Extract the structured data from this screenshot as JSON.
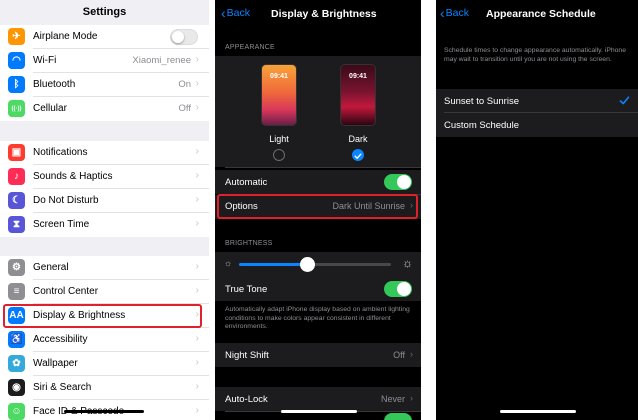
{
  "panel1": {
    "title": "Settings",
    "group1": [
      {
        "label": "Airplane Mode",
        "icon": "airplane-icon",
        "color": "#ff9500",
        "glyph": "✈",
        "type": "toggle",
        "toggle_on": false
      },
      {
        "label": "Wi-Fi",
        "icon": "wifi-icon",
        "color": "#007aff",
        "glyph": "◠",
        "value": "Xiaomi_renee",
        "type": "nav"
      },
      {
        "label": "Bluetooth",
        "icon": "bluetooth-icon",
        "color": "#007aff",
        "glyph": "ᛒ",
        "value": "On",
        "type": "nav"
      },
      {
        "label": "Cellular",
        "icon": "cellular-icon",
        "color": "#4cd964",
        "glyph": "((·))",
        "value": "Off",
        "type": "nav"
      }
    ],
    "group2": [
      {
        "label": "Notifications",
        "icon": "notifications-icon",
        "color": "#ff3b30",
        "glyph": "▣"
      },
      {
        "label": "Sounds & Haptics",
        "icon": "sounds-icon",
        "color": "#ff2d55",
        "glyph": "♪"
      },
      {
        "label": "Do Not Disturb",
        "icon": "moon-icon",
        "color": "#5856d6",
        "glyph": "☾"
      },
      {
        "label": "Screen Time",
        "icon": "hourglass-icon",
        "color": "#5856d6",
        "glyph": "⧗"
      }
    ],
    "group3": [
      {
        "label": "General",
        "icon": "gear-icon",
        "color": "#8e8e93",
        "glyph": "⚙"
      },
      {
        "label": "Control Center",
        "icon": "control-center-icon",
        "color": "#8e8e93",
        "glyph": "≡"
      },
      {
        "label": "Display & Brightness",
        "icon": "display-brightness-icon",
        "color": "#007aff",
        "glyph": "AA"
      },
      {
        "label": "Accessibility",
        "icon": "accessibility-icon",
        "color": "#007aff",
        "glyph": "♿"
      },
      {
        "label": "Wallpaper",
        "icon": "wallpaper-icon",
        "color": "#34aadc",
        "glyph": "✿"
      },
      {
        "label": "Siri & Search",
        "icon": "siri-icon",
        "color": "#1c1c1e",
        "glyph": "◉"
      },
      {
        "label": "Face ID & Passcode",
        "icon": "faceid-icon",
        "color": "#4cd964",
        "glyph": "☺"
      }
    ]
  },
  "panel2": {
    "back_label": "Back",
    "title": "Display & Brightness",
    "appearance_header": "APPEARANCE",
    "light": {
      "time": "09:41",
      "label": "Light",
      "selected": false
    },
    "dark": {
      "time": "09:41",
      "label": "Dark",
      "selected": true
    },
    "automatic_label": "Automatic",
    "automatic_on": true,
    "options_label": "Options",
    "options_value": "Dark Until Sunrise",
    "brightness_header": "BRIGHTNESS",
    "brightness_level": 0.45,
    "true_tone_label": "True Tone",
    "true_tone_on": true,
    "true_tone_desc": "Automatically adapt iPhone display based on ambient lighting conditions to make colors appear consistent in different environments.",
    "night_shift_label": "Night Shift",
    "night_shift_value": "Off",
    "auto_lock_label": "Auto-Lock",
    "auto_lock_value": "Never"
  },
  "panel3": {
    "back_label": "Back",
    "title": "Appearance Schedule",
    "description": "Schedule times to change appearance automatically. iPhone may wait to transition until you are not using the screen.",
    "options": [
      {
        "label": "Sunset to Sunrise",
        "selected": true
      },
      {
        "label": "Custom Schedule",
        "selected": false
      }
    ]
  },
  "colors": {
    "ios_blue": "#0a84ff",
    "ios_green": "#34c759",
    "highlight_red": "#e0202a"
  }
}
